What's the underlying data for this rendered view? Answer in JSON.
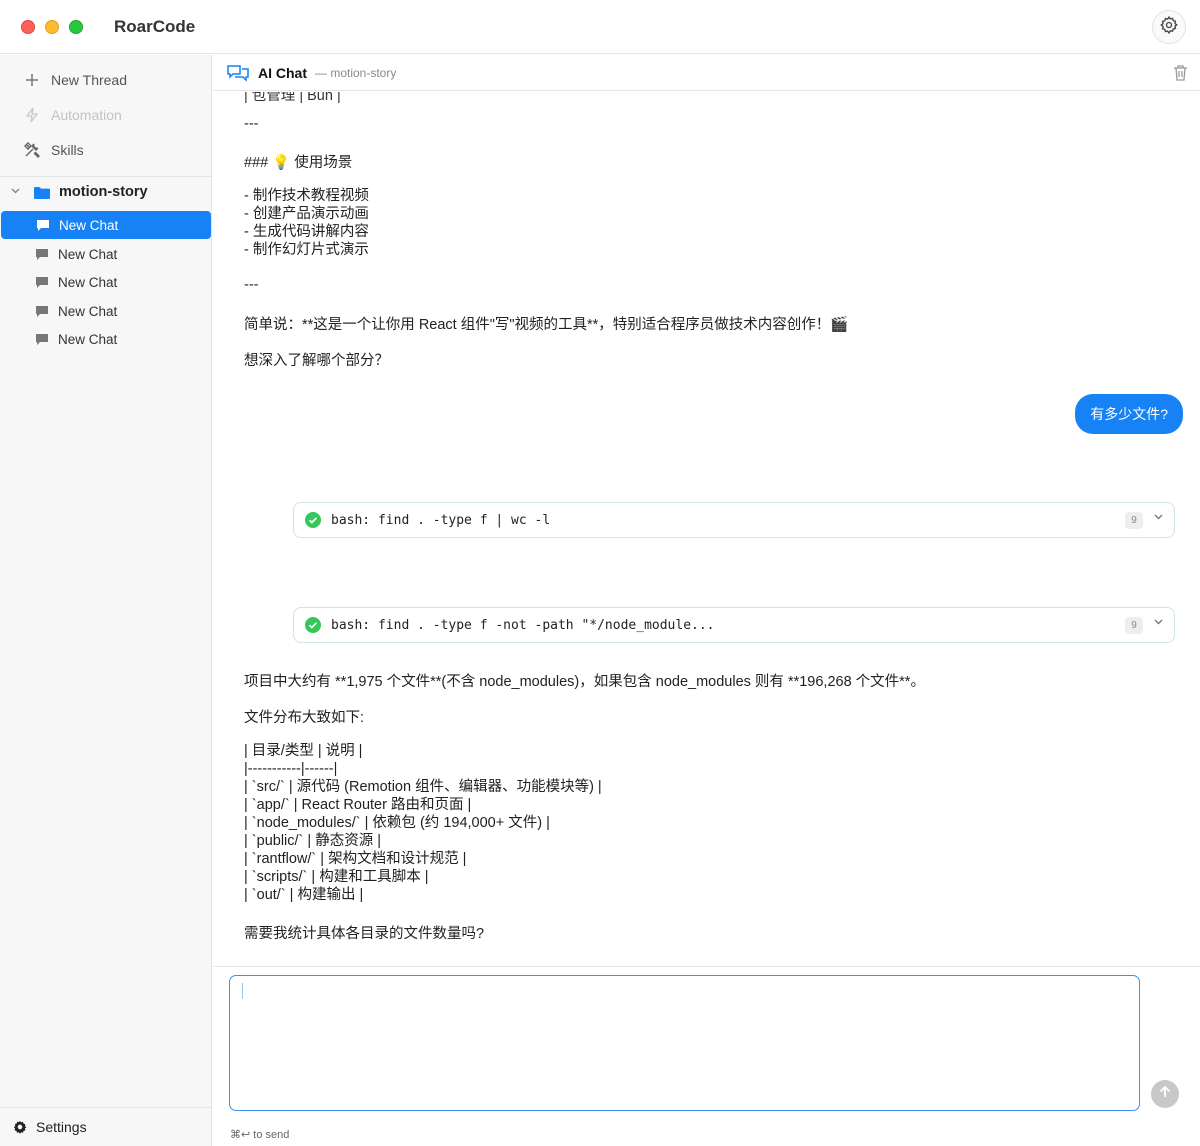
{
  "window": {
    "app_title": "RoarCode"
  },
  "sidebar": {
    "actions": [
      {
        "label": "New Thread",
        "icon": "plus-icon"
      },
      {
        "label": "Automation",
        "icon": "lightning-icon"
      },
      {
        "label": "Skills",
        "icon": "tools-icon"
      }
    ],
    "project": {
      "name": "motion-story",
      "icon": "folder-icon"
    },
    "chats": [
      "New Chat",
      "New Chat",
      "New Chat",
      "New Chat",
      "New Chat"
    ],
    "settings_label": "Settings"
  },
  "header": {
    "title": "AI Chat",
    "subtitle": "— motion-story"
  },
  "messages": {
    "clipped_line": "| 包管理 | Bun |",
    "assistant_1": [
      "---",
      "### 💡 使用场景",
      "- 制作技术教程视频\n- 创建产品演示动画\n- 生成代码讲解内容\n- 制作幻灯片式演示",
      "---",
      "简单说：**这是一个让你用 React 组件\"写\"视频的工具**，特别适合程序员做技术内容创作！🎬",
      "想深入了解哪个部分？"
    ],
    "user_1": "有多少文件?",
    "tool_calls": [
      {
        "command": "bash: find . -type f | wc -l",
        "badge": "9"
      },
      {
        "command": "bash: find . -type f -not -path \"*/node_module...",
        "badge": "9"
      }
    ],
    "assistant_2": [
      "项目中大约有 **1,975 个文件**(不含 node_modules)，如果包含 node_modules 则有 **196,268 个文件**。",
      "文件分布大致如下:",
      "| 目录/类型 | 说明 |\n|-----------|------|\n| `src/` | 源代码 (Remotion 组件、编辑器、功能模块等) |\n| `app/` | React Router 路由和页面 |\n| `node_modules/` | 依赖包 (约 194,000+ 文件) |\n| `public/` | 静态资源 |\n| `rantflow/` | 架构文档和设计规范 |\n| `scripts/` | 构建和工具脚本 |\n| `out/` | 构建输出 |",
      "需要我统计具体各目录的文件数量吗?"
    ]
  },
  "composer": {
    "value": "",
    "hint": "⌘↩ to send"
  },
  "colors": {
    "accent": "#1682f5",
    "success": "#34c759"
  }
}
